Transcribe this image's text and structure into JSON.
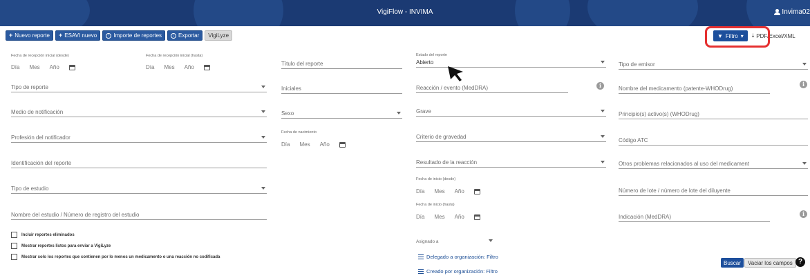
{
  "header": {
    "title": "VigiFlow - INVIMA",
    "user": "Invima02"
  },
  "toolbar": {
    "nuevo_reporte": "Nuevo reporte",
    "esavi_nuevo": "ESAVI nuevo",
    "importe": "Importe de reportes",
    "exportar": "Exportar",
    "vigilyze": "VigiLyze",
    "filtro": "Filtro",
    "pdf": "PDF/Excel/XML"
  },
  "col1": {
    "fecha_desde": "Fecha de recepción inicial (desde)",
    "fecha_hasta": "Fecha de recepción inicial (hasta)",
    "dia": "Día",
    "mes": "Mes",
    "ano": "Año",
    "tipo_reporte": "Tipo de reporte",
    "medio": "Medio de notificación",
    "profesion": "Profesión del notificador",
    "identificacion": "Identificación del reporte",
    "tipo_estudio": "Tipo de estudio",
    "nombre_estudio": "Nombre del estudio / Número de registro del estudio",
    "chk_eliminados": "Incluir reportes eliminados",
    "chk_listos": "Mostrar reportes listos para enviar a VigiLyze",
    "chk_solo": "Mostrar solo los reportes que contienen por lo menos un medicamento o una reacción no codificada"
  },
  "col2": {
    "titulo": "Título del reporte",
    "iniciales": "Iniciales",
    "sexo": "Sexo",
    "fecha_nacimiento": "Fecha de nacimiento"
  },
  "col3": {
    "estado_label": "Estado del reporte",
    "estado_value": "Abierto",
    "reaccion": "Reacción / evento (MedDRA)",
    "grave": "Grave",
    "criterio": "Criterio de gravedad",
    "resultado": "Resultado de la reacción",
    "fecha_inicio_desde": "Fecha de inicio (desde)",
    "fecha_inicio_hasta": "Fecha de inicio (hasta)",
    "asignado": "Asignado a",
    "delegado": "Delegado a organización: Filtro",
    "creado": "Creado por organización: Filtro"
  },
  "col4": {
    "tipo_emisor": "Tipo de emisor",
    "nombre_medicamento": "Nombre del medicamento (patente-WHODrug)",
    "principio": "Principio(s) activo(s) (WHODrug)",
    "codigo_atc": "Código ATC",
    "otros_problemas": "Otros problemas relacionados al uso del medicament",
    "numero_lote": "Número de lote / número de lote del diluyente",
    "indicacion": "Indicación (MedDRA)"
  },
  "actions": {
    "buscar": "Buscar",
    "vaciar": "Vaciar los campos",
    "help": "?"
  },
  "colors": {
    "header": "#1b3a73",
    "primary": "#2b5aa0",
    "highlight": "#e53030"
  }
}
